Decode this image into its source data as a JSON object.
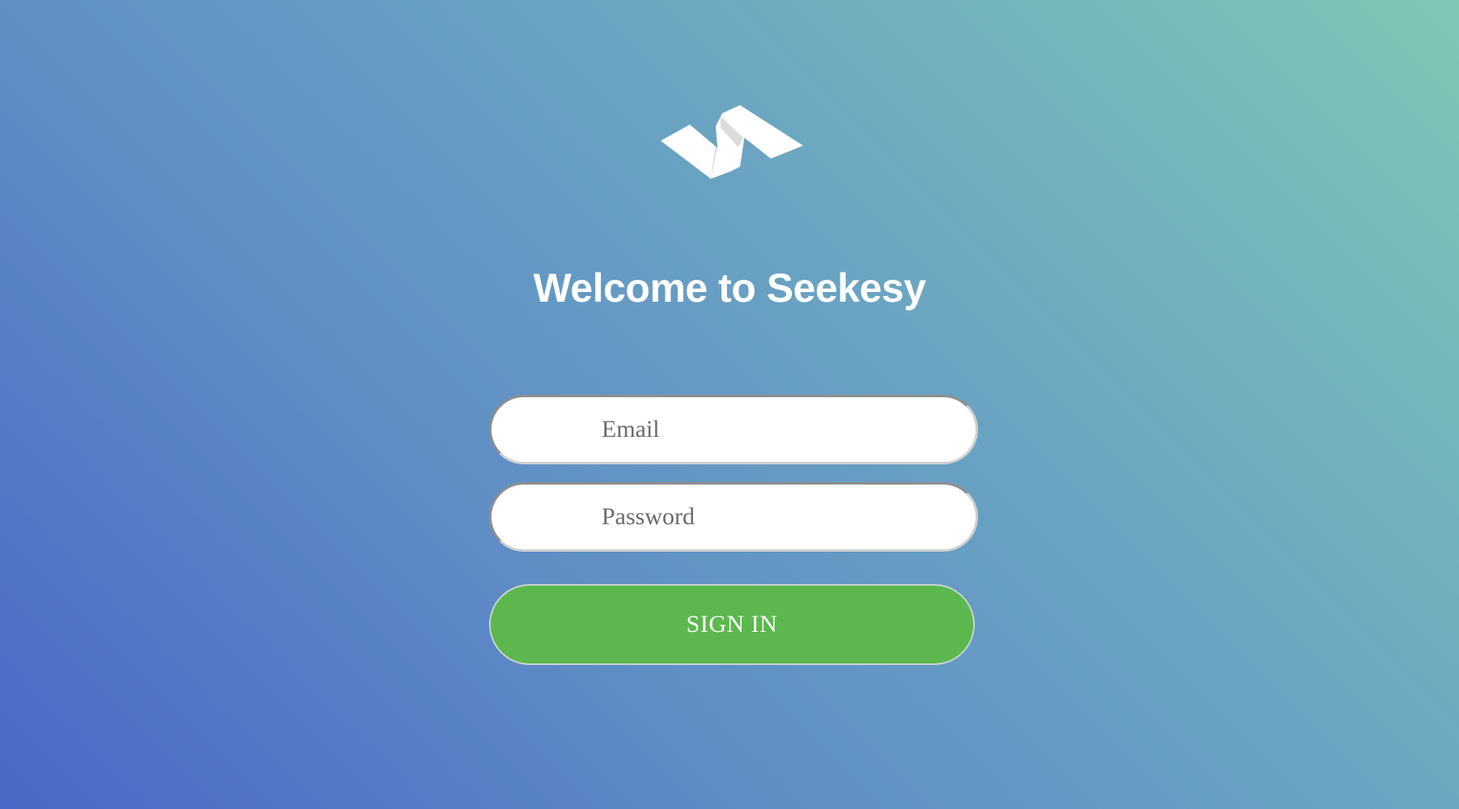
{
  "app": {
    "logo_icon": "seekesy-ribbon-logo-icon",
    "title": "Welcome to Seekesy"
  },
  "form": {
    "email_placeholder": "Email",
    "password_placeholder": "Password",
    "signin_label": "SIGN IN"
  },
  "colors": {
    "gradient_top_right": "#7fc7b5",
    "gradient_bottom_left": "#4a68c7",
    "signin_button": "#5cb84e",
    "title_text": "#ffffff"
  }
}
